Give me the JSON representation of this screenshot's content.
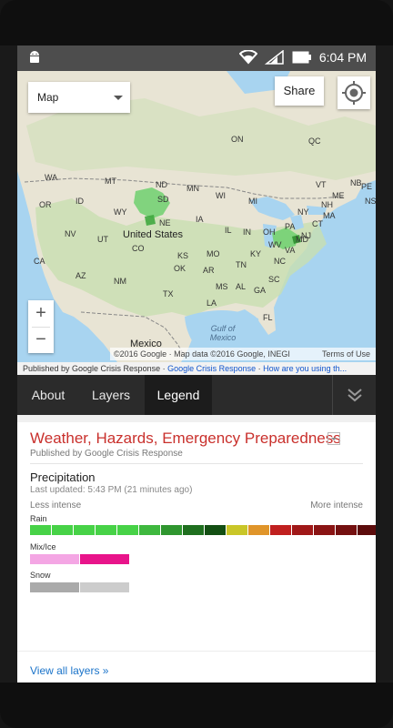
{
  "status_bar": {
    "time": "6:04 PM",
    "icons": [
      "android-icon",
      "wifi-icon",
      "signal-icon",
      "battery-icon"
    ]
  },
  "map": {
    "type_selector": {
      "value": "Map"
    },
    "share_label": "Share",
    "zoom_in": "+",
    "zoom_out": "−",
    "attribution": "©2016 Google · Map data ©2016 Google, INEGI",
    "terms": "Terms of Use",
    "labels": {
      "united_states": "United States",
      "mexico": "Mexico",
      "gulf": "Gulf of Mexico",
      "on": "ON",
      "qc": "QC",
      "pe": "PE",
      "ns": "NS",
      "nb": "NB",
      "me": "ME",
      "wa": "WA",
      "mt": "MT",
      "nd": "ND",
      "mn": "MN",
      "or": "OR",
      "id": "ID",
      "wy": "WY",
      "sd": "SD",
      "wi": "WI",
      "mi": "MI",
      "ny": "NY",
      "vt": "VT",
      "nh": "NH",
      "ma": "MA",
      "ct": "CT",
      "nv": "NV",
      "ut": "UT",
      "co": "CO",
      "ne": "NE",
      "ia": "IA",
      "il": "IL",
      "in": "IN",
      "oh": "OH",
      "pa": "PA",
      "nj": "NJ",
      "ca": "CA",
      "ks": "KS",
      "mo": "MO",
      "ky": "KY",
      "wv": "WV",
      "va": "VA",
      "md": "MD",
      "az": "AZ",
      "nm": "NM",
      "ok": "OK",
      "ar": "AR",
      "tn": "TN",
      "nc": "NC",
      "ms": "MS",
      "al": "AL",
      "ga": "GA",
      "sc": "SC",
      "tx": "TX",
      "la": "LA",
      "fl": "FL"
    }
  },
  "published_bar": {
    "prefix": "Published by Google Crisis Response · ",
    "link1": "Google Crisis Response",
    "sep": " · ",
    "link2": "How are you using th..."
  },
  "tabs": [
    {
      "label": "About",
      "active": false
    },
    {
      "label": "Layers",
      "active": false
    },
    {
      "label": "Legend",
      "active": true
    }
  ],
  "legend": {
    "layer_title": "Weather, Hazards, Emergency Preparedness",
    "published_by": "Published by Google Crisis Response",
    "precip_title": "Precipitation",
    "last_updated": "Last updated: 5:43 PM (21 minutes ago)",
    "less_intense": "Less intense",
    "more_intense": "More intense",
    "rain_label": "Rain",
    "mix_label": "Mix/Ice",
    "snow_label": "Snow",
    "rain_colors": [
      "#47d247",
      "#47d247",
      "#47d247",
      "#47d247",
      "#47d247",
      "#3fb83f",
      "#2f962f",
      "#1f6f1f",
      "#134f13",
      "#c9c628",
      "#e0952a",
      "#c0201f",
      "#a01818",
      "#8a1414",
      "#741010",
      "#5c0c0c"
    ],
    "mix_colors": [
      "#f4a6e4",
      "#e8148a"
    ],
    "snow_colors": [
      "#aaaaaa",
      "#cccccc"
    ],
    "view_all": "View all layers »"
  }
}
